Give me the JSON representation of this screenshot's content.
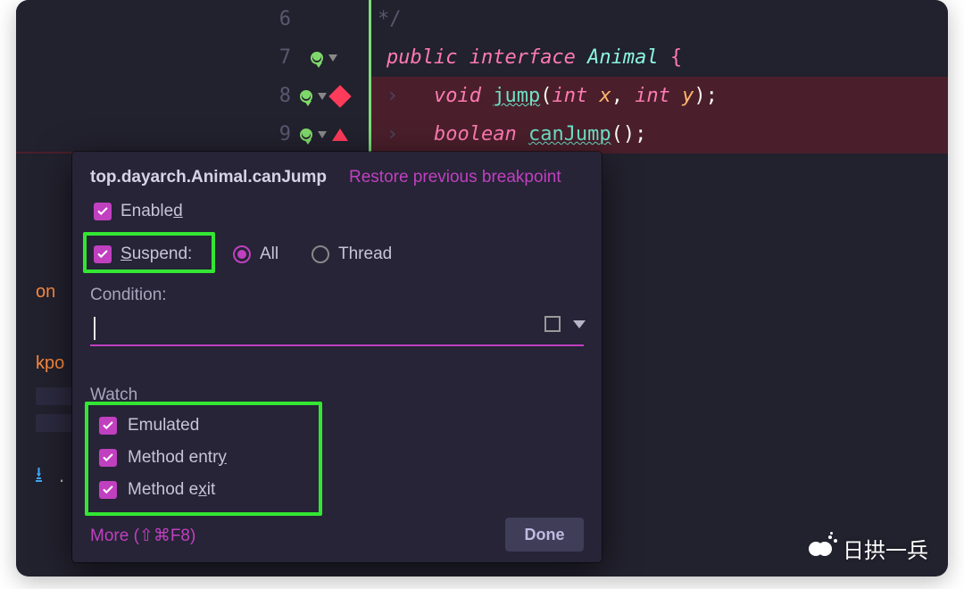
{
  "editor": {
    "lines": [
      {
        "num": "6",
        "tokens": [
          {
            "cls": "cm",
            "txt": "*/"
          }
        ]
      },
      {
        "num": "7",
        "tokens": [
          {
            "cls": "kw",
            "txt": "public "
          },
          {
            "cls": "kw",
            "txt": "interface "
          },
          {
            "cls": "type",
            "txt": "Animal "
          },
          {
            "cls": "brace",
            "txt": "{"
          }
        ]
      },
      {
        "num": "8",
        "tokens": [
          {
            "cls": "ret",
            "txt": "void "
          },
          {
            "cls": "fn-u",
            "txt": "jump"
          },
          {
            "cls": "pn",
            "txt": "("
          },
          {
            "cls": "ret",
            "txt": "int "
          },
          {
            "cls": "par",
            "txt": "x"
          },
          {
            "cls": "pn",
            "txt": ", "
          },
          {
            "cls": "ret",
            "txt": "int "
          },
          {
            "cls": "par",
            "txt": "y"
          },
          {
            "cls": "pn",
            "txt": ");"
          }
        ]
      },
      {
        "num": "9",
        "tokens": [
          {
            "cls": "ret",
            "txt": "boolean "
          },
          {
            "cls": "fn-u",
            "txt": "canJump"
          },
          {
            "cls": "pn",
            "txt": "();"
          }
        ]
      }
    ]
  },
  "side": {
    "frag1": "on",
    "frag2": "kpo"
  },
  "popup": {
    "title": "top.dayarch.Animal.canJump",
    "restore": "Restore previous breakpoint",
    "enabled_label_pre": "Enable",
    "enabled_label_u": "d",
    "suspend_label_u": "S",
    "suspend_label_post": "uspend:",
    "radio_all": "All",
    "radio_thread": "Thread",
    "condition_label": "Condition:",
    "watch_label": "Watch",
    "watch_items": {
      "emulated": "Emulated",
      "method_entry_pre": "Method entr",
      "method_entry_u": "y",
      "method_exit_pre": "Method e",
      "method_exit_u": "x",
      "method_exit_post": "it"
    },
    "more": "More (⇧⌘F8)",
    "done": "Done"
  },
  "watermark": "日拱一兵"
}
